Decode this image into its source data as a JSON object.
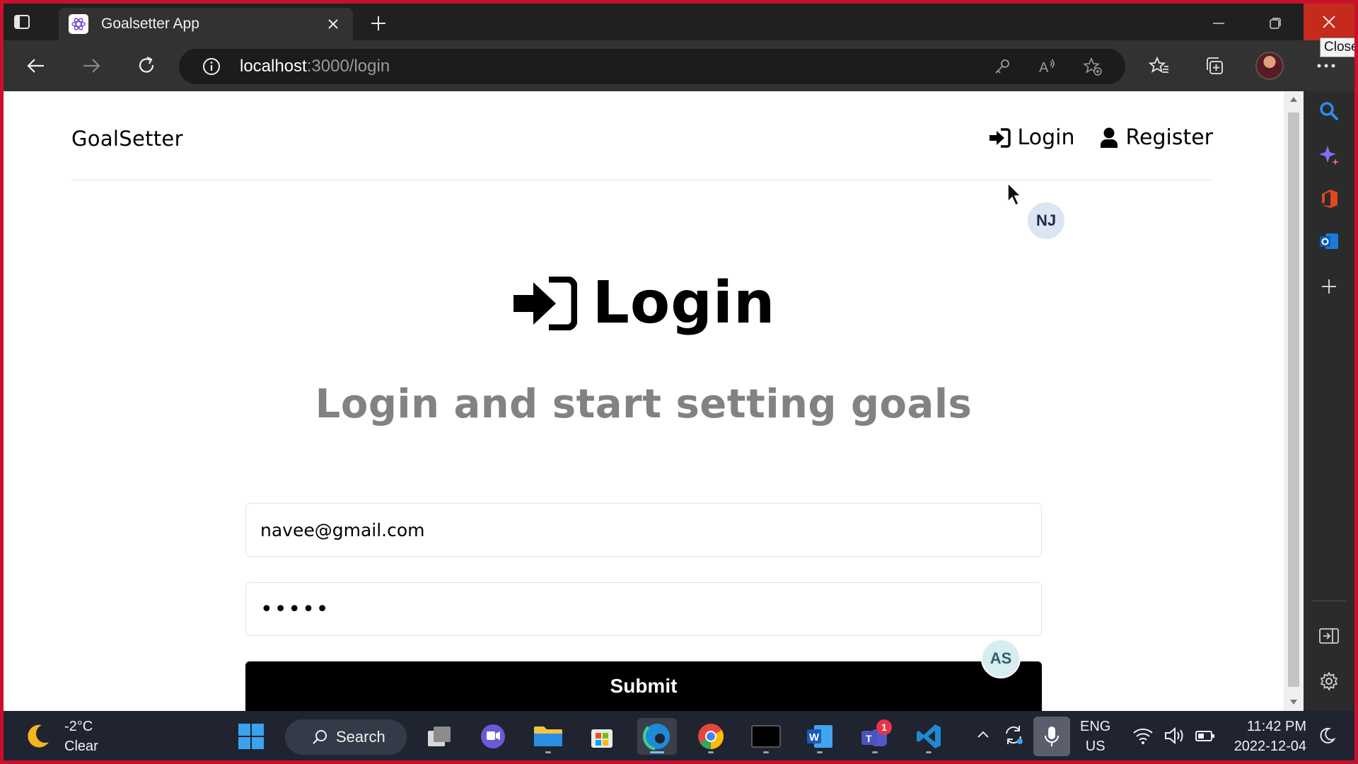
{
  "browser": {
    "tab": {
      "title": "Goalsetter App"
    },
    "close_tooltip": "Close",
    "url": {
      "host": "localhost",
      "path": ":3000/login"
    }
  },
  "app": {
    "brand": "GoalSetter",
    "nav": {
      "login_label": "Login",
      "register_label": "Register"
    },
    "heading": "Login",
    "subtitle": "Login and start setting goals",
    "form": {
      "email_value": "navee@gmail.com",
      "password_value": "•••••",
      "submit_label": "Submit"
    },
    "presence": [
      {
        "initials": "NJ"
      },
      {
        "initials": "AS"
      }
    ]
  },
  "taskbar": {
    "weather": {
      "temp": "-2°C",
      "condition": "Clear"
    },
    "search_label": "Search",
    "teams_badge": "1",
    "language": {
      "line1": "ENG",
      "line2": "US"
    },
    "clock": {
      "time": "11:42 PM",
      "date": "2022-12-04"
    }
  },
  "colors": {
    "frame_border": "#c8102e",
    "submit_bg": "#000000",
    "subtitle": "#828282",
    "taskbar_bg": "#1f2430"
  }
}
